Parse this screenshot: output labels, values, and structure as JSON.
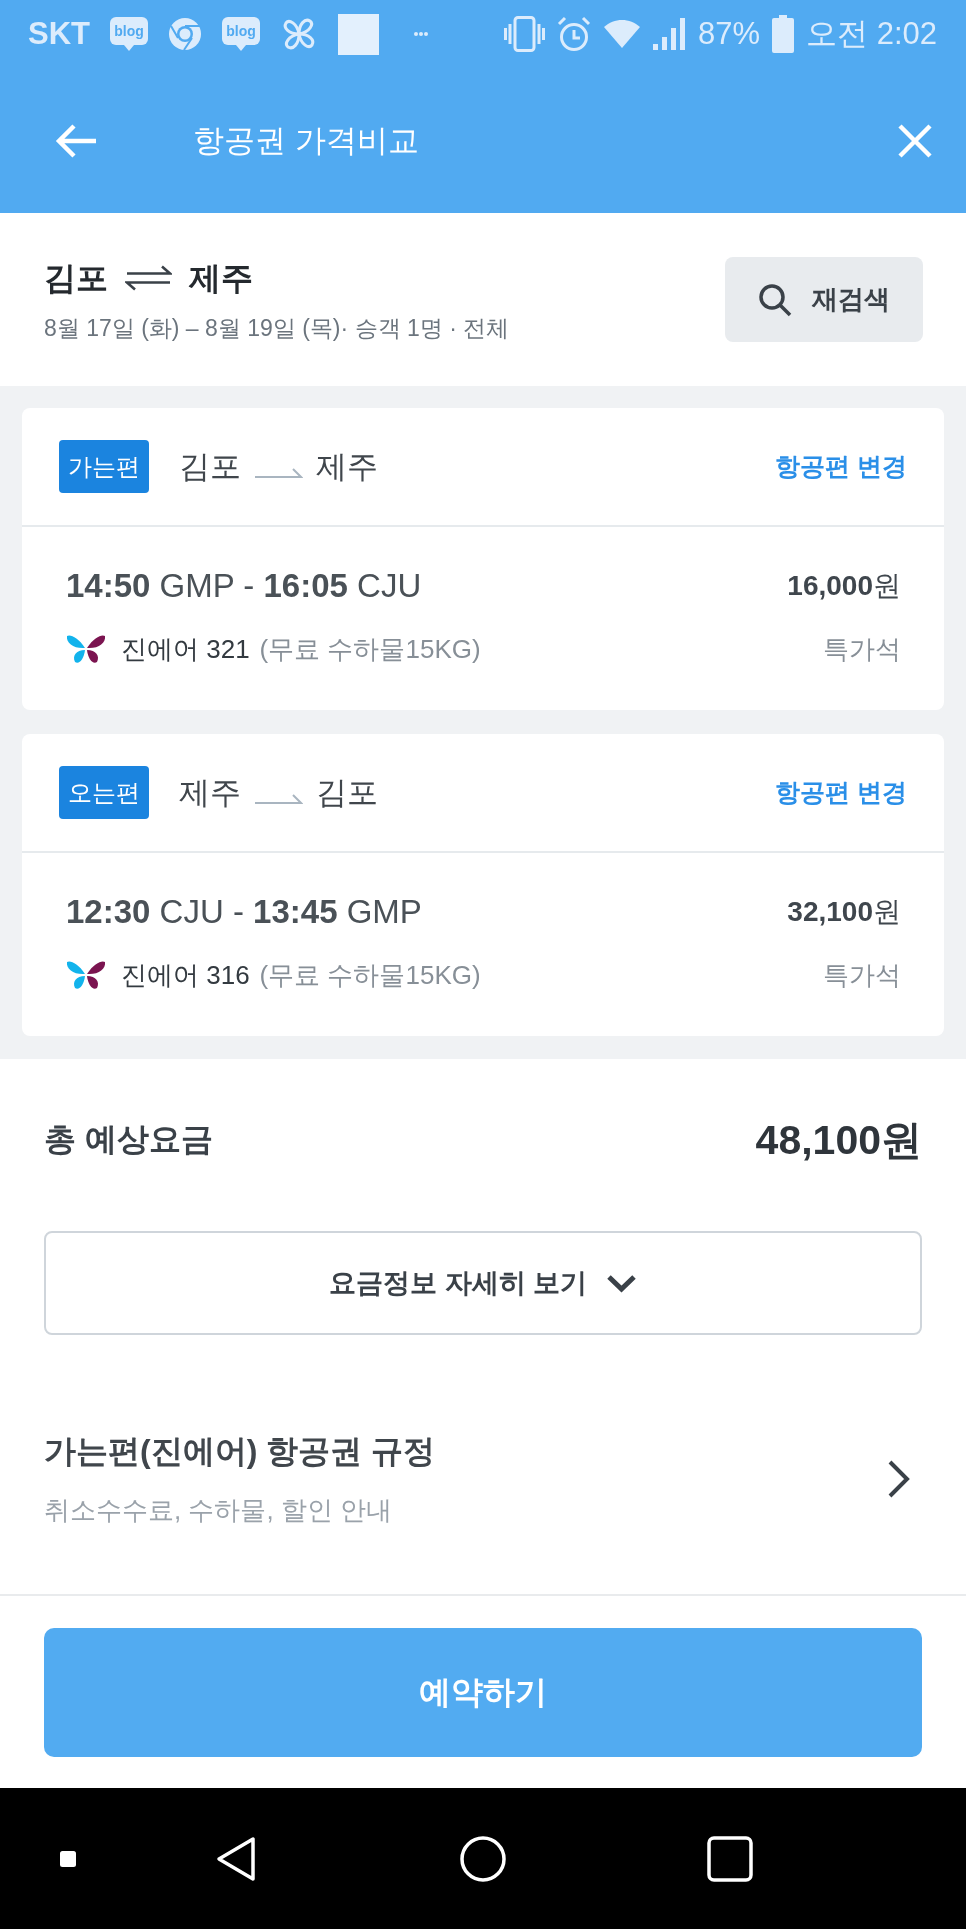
{
  "status_bar": {
    "carrier": "SKT",
    "notifications": [
      {
        "kind": "blog",
        "label": "blog"
      },
      {
        "kind": "ring"
      },
      {
        "kind": "blog",
        "label": "blog"
      },
      {
        "kind": "pinwheel"
      },
      {
        "kind": "square"
      },
      {
        "kind": "more"
      }
    ],
    "battery_percent": "87%",
    "time": "오전 2:02"
  },
  "app_bar": {
    "title": "항공권 가격비교"
  },
  "search_summary": {
    "origin": "김포",
    "destination": "제주",
    "details": "8월 17일 (화) – 8월 19일 (목)· 승객 1명 · 전체",
    "button": "재검색"
  },
  "legs": [
    {
      "badge": "가는편",
      "origin": "김포",
      "destination": "제주",
      "change_link": "항공편 변경",
      "times": "**14:50** GMP - **16:05** CJU",
      "price": "**16,000**원",
      "airline": "진에어 321",
      "baggage": "(무료 수하물15KG)",
      "fare_class": "특가석"
    },
    {
      "badge": "오는편",
      "origin": "제주",
      "destination": "김포",
      "change_link": "항공편 변경",
      "times": "**12:30** CJU - **13:45** GMP",
      "price": "**32,100**원",
      "airline": "진에어 316",
      "baggage": "(무료 수하물15KG)",
      "fare_class": "특가석"
    }
  ],
  "total": {
    "label": "총 예상요금",
    "amount": "48,100원"
  },
  "fare_details_button": {
    "label": "요금정보 자세히 보기",
    "expanded": false
  },
  "rules_link": {
    "title": "가는편(진에어) 항공권 규정",
    "subtitle": "취소수수료, 수하물, 할인 안내"
  },
  "book_button": "예약하기"
}
